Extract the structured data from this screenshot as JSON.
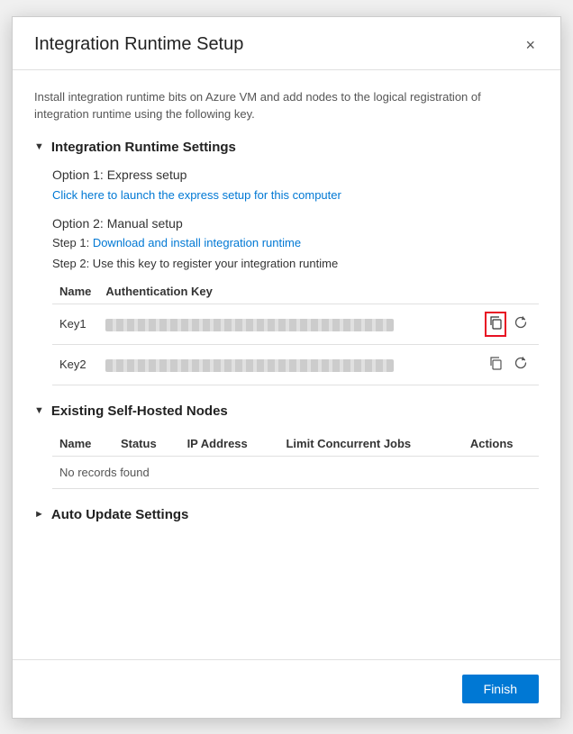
{
  "dialog": {
    "title": "Integration Runtime Setup",
    "close_label": "×"
  },
  "intro": {
    "text": "Install integration runtime bits on Azure VM and add nodes to the logical registration of integration runtime using the following key."
  },
  "integration_runtime_settings": {
    "section_title": "Integration Runtime Settings",
    "option1_label": "Option 1: Express setup",
    "express_setup_link": "Click here to launch the express setup for this computer",
    "option2_label": "Option 2: Manual setup",
    "step1_prefix": "Step 1: ",
    "step1_link": "Download and install integration runtime",
    "step2_text": "Step 2: Use this key to register your integration runtime",
    "table": {
      "col_name": "Name",
      "col_auth_key": "Authentication Key",
      "rows": [
        {
          "name": "Key1",
          "value": "••••••••••••••••••••••••••••••••••••••••••••••••••••"
        },
        {
          "name": "Key2",
          "value": "••••••••••••••••••••••••••••••••••••••••••••••••••••"
        }
      ]
    }
  },
  "existing_nodes": {
    "section_title": "Existing Self-Hosted Nodes",
    "col_name": "Name",
    "col_status": "Status",
    "col_ip": "IP Address",
    "col_limit": "Limit Concurrent Jobs",
    "col_actions": "Actions",
    "empty_text": "No records found"
  },
  "auto_update": {
    "section_title": "Auto Update Settings"
  },
  "footer": {
    "finish_label": "Finish"
  }
}
